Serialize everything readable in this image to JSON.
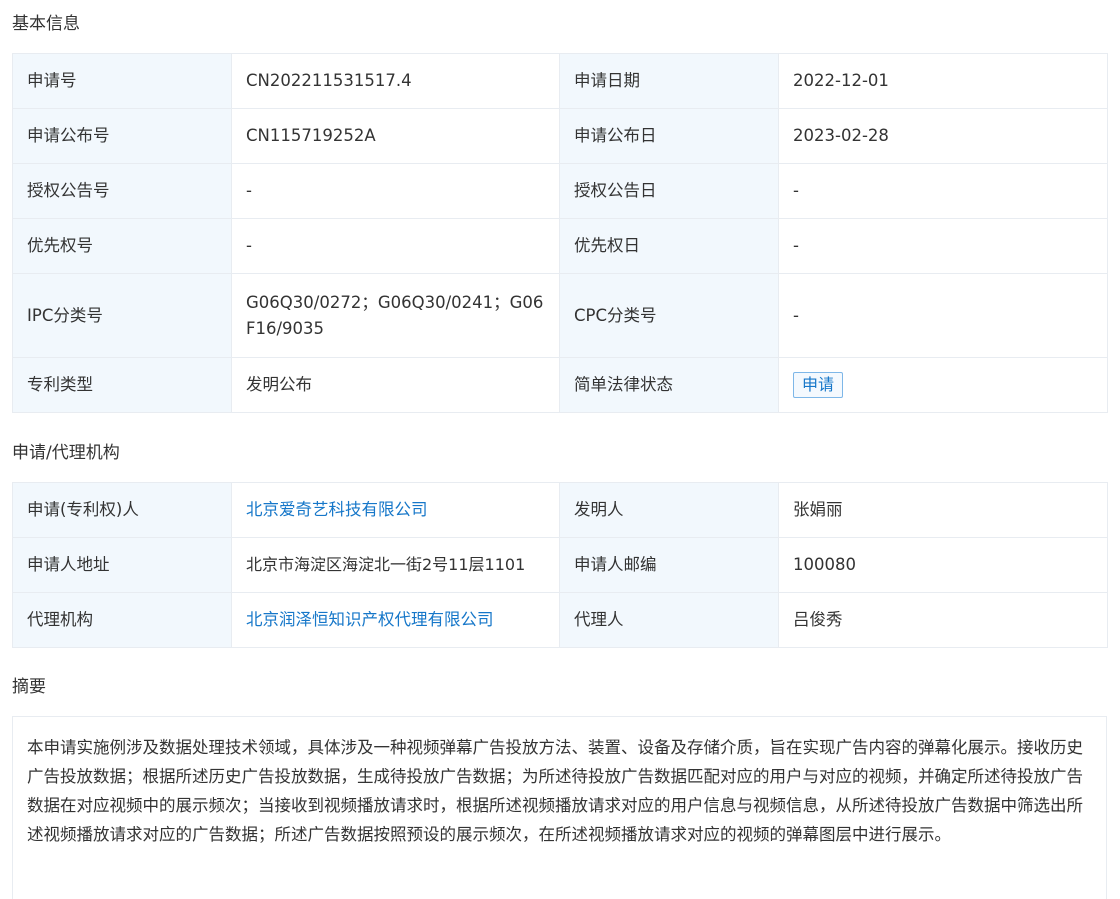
{
  "basic": {
    "title": "基本信息",
    "rows": [
      {
        "l1": "申请号",
        "v1": "CN202211531517.4",
        "l2": "申请日期",
        "v2": "2022-12-01"
      },
      {
        "l1": "申请公布号",
        "v1": "CN115719252A",
        "l2": "申请公布日",
        "v2": "2023-02-28"
      },
      {
        "l1": "授权公告号",
        "v1": "-",
        "l2": "授权公告日",
        "v2": "-"
      },
      {
        "l1": "优先权号",
        "v1": "-",
        "l2": "优先权日",
        "v2": "-"
      },
      {
        "l1": "IPC分类号",
        "v1": "G06Q30/0272；G06Q30/0241；G06F16/9035",
        "l2": "CPC分类号",
        "v2": "-"
      },
      {
        "l1": "专利类型",
        "v1": "发明公布",
        "l2": "简单法律状态",
        "v2": "申请"
      }
    ]
  },
  "agency": {
    "title": "申请/代理机构",
    "rows": [
      {
        "l1": "申请(专利权)人",
        "v1": "北京爱奇艺科技有限公司",
        "l2": "发明人",
        "v2": "张娟丽"
      },
      {
        "l1": "申请人地址",
        "v1": "北京市海淀区海淀北一街2号11层1101",
        "l2": "申请人邮编",
        "v2": "100080"
      },
      {
        "l1": "代理机构",
        "v1": "北京润泽恒知识产权代理有限公司",
        "l2": "代理人",
        "v2": "吕俊秀"
      }
    ]
  },
  "abstract": {
    "title": "摘要",
    "text": "本申请实施例涉及数据处理技术领域，具体涉及一种视频弹幕广告投放方法、装置、设备及存储介质，旨在实现广告内容的弹幕化展示。接收历史广告投放数据；根据所述历史广告投放数据，生成待投放广告数据；为所述待投放广告数据匹配对应的用户与对应的视频，并确定所述待投放广告数据在对应视频中的展示频次；当接收到视频播放请求时，根据所述视频播放请求对应的用户信息与视频信息，从所述待投放广告数据中筛选出所述视频播放请求对应的广告数据；所述广告数据按照预设的展示频次，在所述视频播放请求对应的视频的弹幕图层中进行展示。"
  },
  "colors": {
    "label_bg": "#f2f8fd",
    "border": "#e8ecf1",
    "link": "#1677c9"
  }
}
